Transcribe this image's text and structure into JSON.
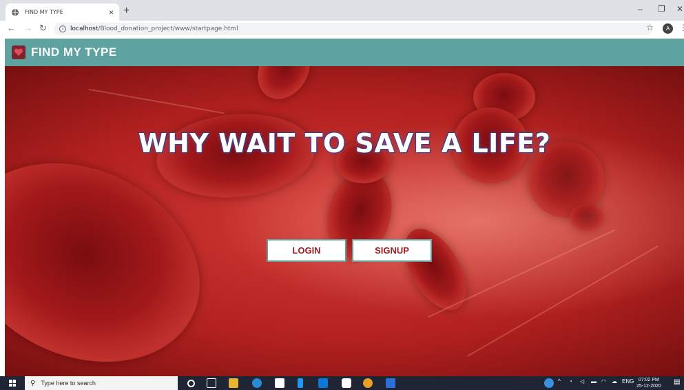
{
  "browser": {
    "tab_title": "FIND MY TYPE",
    "tab_close": "×",
    "new_tab": "+",
    "url_host": "localhost",
    "url_path": "/Blood_donation_project/www/startpage.html",
    "avatar_letter": "A",
    "window_controls": {
      "minimize": "–",
      "maximize": "❐",
      "close": "✕"
    }
  },
  "site": {
    "title": "FIND MY TYPE"
  },
  "hero": {
    "headline": "WHY WAIT TO SAVE A LIFE?",
    "login_label": "LOGIN",
    "signup_label": "SIGNUP"
  },
  "taskbar": {
    "search_placeholder": "Type here to search",
    "language": "ENG",
    "time": "07:02 PM",
    "date": "25-12-2020"
  },
  "colors": {
    "header": "#5fa3a0",
    "button_text": "#a51c1f",
    "taskbar": "#1f2535"
  }
}
